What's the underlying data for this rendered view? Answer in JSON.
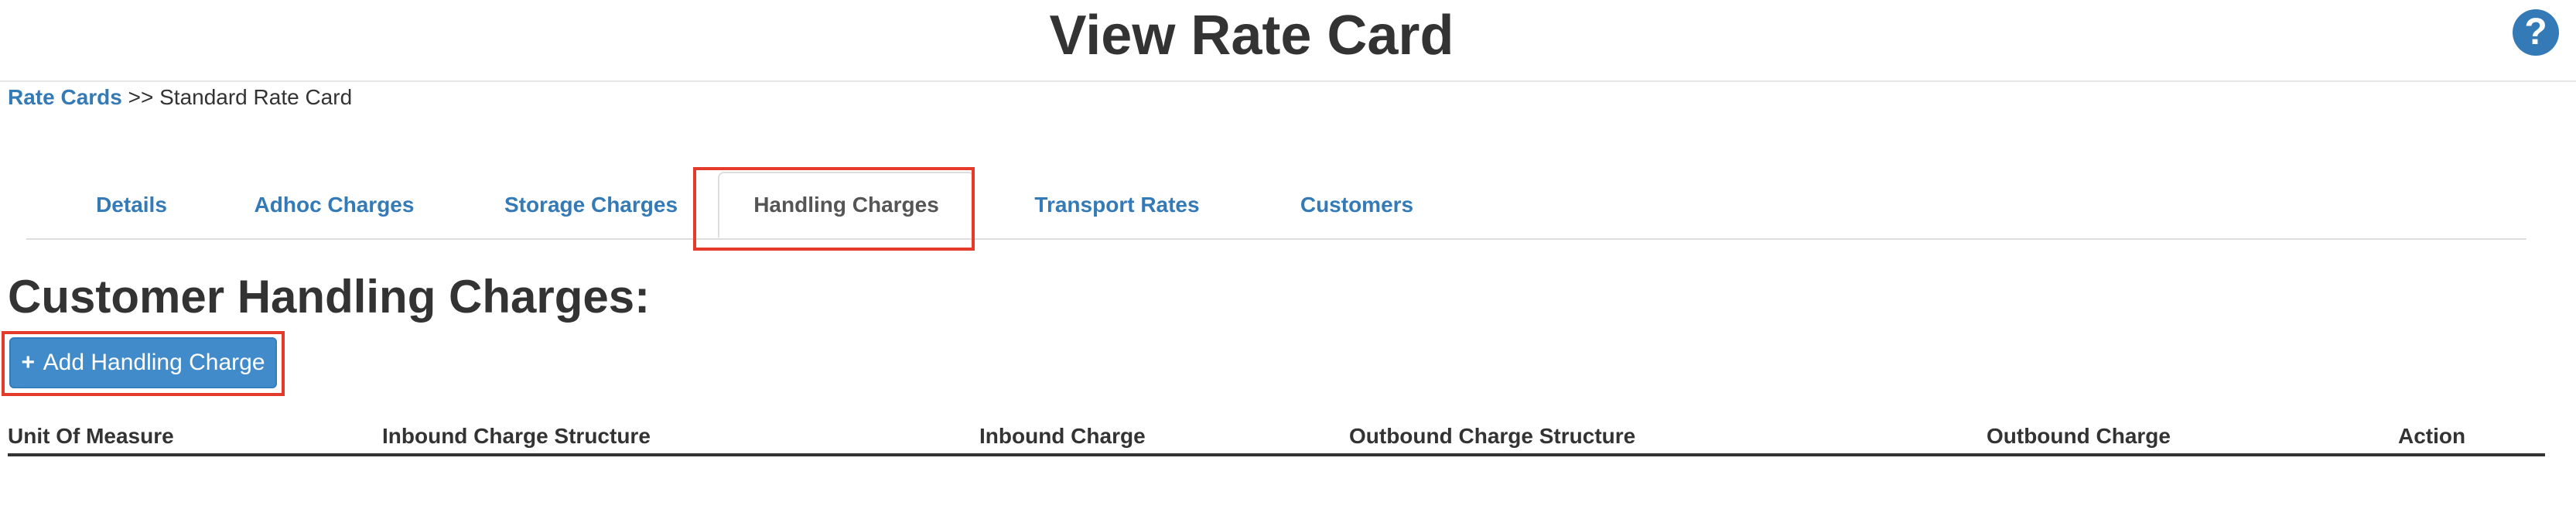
{
  "header": {
    "title": "View Rate Card",
    "help_icon": "question-circle-icon",
    "help_glyph": "?"
  },
  "breadcrumb": {
    "root": "Rate Cards",
    "separator": ">>",
    "current": "Standard Rate Card"
  },
  "tabs": [
    {
      "label": "Details",
      "active": false
    },
    {
      "label": "Adhoc Charges",
      "active": false
    },
    {
      "label": "Storage Charges",
      "active": false
    },
    {
      "label": "Handling Charges",
      "active": true
    },
    {
      "label": "Transport Rates",
      "active": false
    },
    {
      "label": "Customers",
      "active": false
    }
  ],
  "section": {
    "title": "Customer Handling Charges:",
    "add_button_label": "Add Handling Charge",
    "add_button_icon": "plus-icon",
    "add_button_glyph": "+"
  },
  "table": {
    "columns": [
      "Unit Of Measure",
      "Inbound Charge Structure",
      "Inbound Charge",
      "Outbound Charge Structure",
      "Outbound Charge",
      "Action"
    ],
    "rows": []
  },
  "colors": {
    "link": "#337ab7",
    "button": "#428bca",
    "highlight": "#e53b2b"
  }
}
